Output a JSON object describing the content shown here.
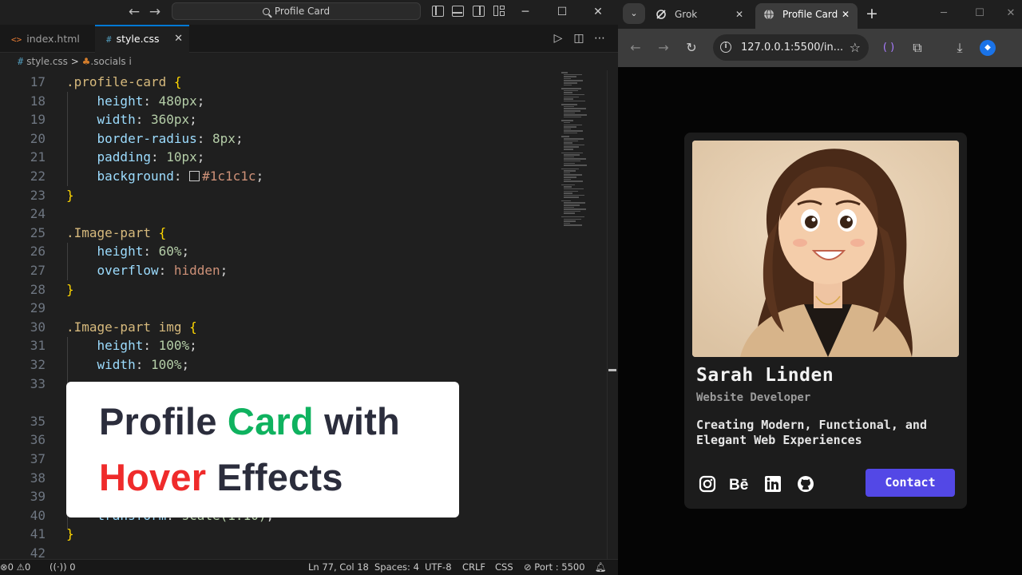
{
  "vscode": {
    "search_label": "Profile Card",
    "tabs": [
      {
        "icon": "<>",
        "label": "index.html"
      },
      {
        "icon": "#",
        "label": "style.css",
        "close": "✕"
      }
    ],
    "breadcrumb": {
      "file": "style.css",
      "symbol": ".socials i"
    },
    "status": {
      "errors": "0",
      "warnings": "0",
      "ports": "0",
      "position": "Ln 77, Col 18",
      "spaces": "Spaces: 4",
      "encoding": "UTF-8",
      "eol": "CRLF",
      "language": "CSS",
      "port": "Port : 5500"
    },
    "lines": {
      "n17": "17",
      "n18": "18",
      "n19": "19",
      "n20": "20",
      "n21": "21",
      "n22": "22",
      "n23": "23",
      "n24": "24",
      "n25": "25",
      "n26": "26",
      "n27": "27",
      "n28": "28",
      "n29": "29",
      "n30": "30",
      "n31": "31",
      "n32": "32",
      "n33": "33",
      "n35": "35",
      "n36": "36",
      "n37": "37",
      "n38": "38",
      "n39": "39",
      "n40": "40",
      "n41": "41",
      "n42": "42",
      "sel_profile": ".profile-card",
      "sel_image_part": ".Image-part",
      "sel_image_part_img": ".Image-part img",
      "open_brace": "{",
      "close_brace": "}",
      "p_height": "height",
      "p_width": "width",
      "p_radius": "border-radius",
      "p_padding": "padding",
      "p_background": "background",
      "p_overflow": "overflow",
      "p_transform": "transform",
      "v_480": "480px",
      "v_360": "360px",
      "v_8": "8px",
      "v_10": "10px",
      "v_bg": "#1c1c1c",
      "v_60": "60%",
      "v_hidden": "hidden",
      "v_100": "100%",
      "v_scale": "scale(1.10)"
    },
    "overlay": {
      "w1": "Profile",
      "w2": "Card",
      "w3": "with",
      "w4": "Hover",
      "w5": "Effects"
    }
  },
  "browser": {
    "tabs": [
      {
        "title": "Grok",
        "close": "✕"
      },
      {
        "title": "Profile Card",
        "close": "✕"
      }
    ],
    "new_tab": "+",
    "url": "127.0.0.1:5500/in...",
    "card": {
      "name": "Sarah Linden",
      "role": "Website Developer",
      "description": "Creating Modern, Functional, and Elegant Web Experiences",
      "contact_label": "Contact",
      "social_icons": [
        "instagram-icon",
        "behance-icon",
        "linkedin-icon",
        "github-icon"
      ]
    }
  },
  "colors": {
    "accent_button": "#5348e6",
    "card_bg": "#1c1c1c",
    "overlay_green": "#0fb25f",
    "overlay_red": "#ef2b2b"
  }
}
